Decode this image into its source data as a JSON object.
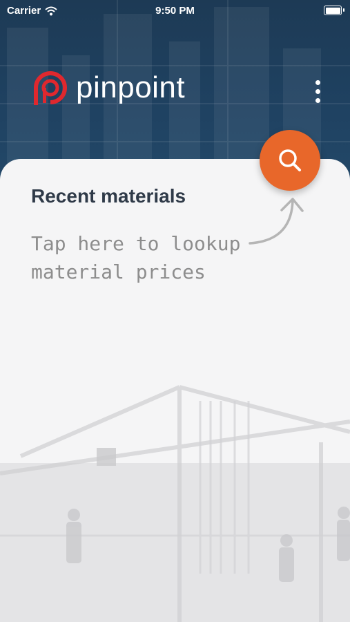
{
  "status_bar": {
    "carrier": "Carrier",
    "time": "9:50 PM",
    "battery_level": 1.0
  },
  "header": {
    "app_name": "pinpoint",
    "logo_icon": "pinpoint-logo-icon",
    "menu_icon": "more-vertical-icon"
  },
  "main": {
    "section_title": "Recent materials",
    "hint": "Tap here to lookup\nmaterial prices",
    "search_icon": "search-icon"
  },
  "colors": {
    "header": "#1f4262",
    "accent": "#e8672a",
    "logo_red": "#e0282e",
    "card": "#f5f5f6"
  }
}
